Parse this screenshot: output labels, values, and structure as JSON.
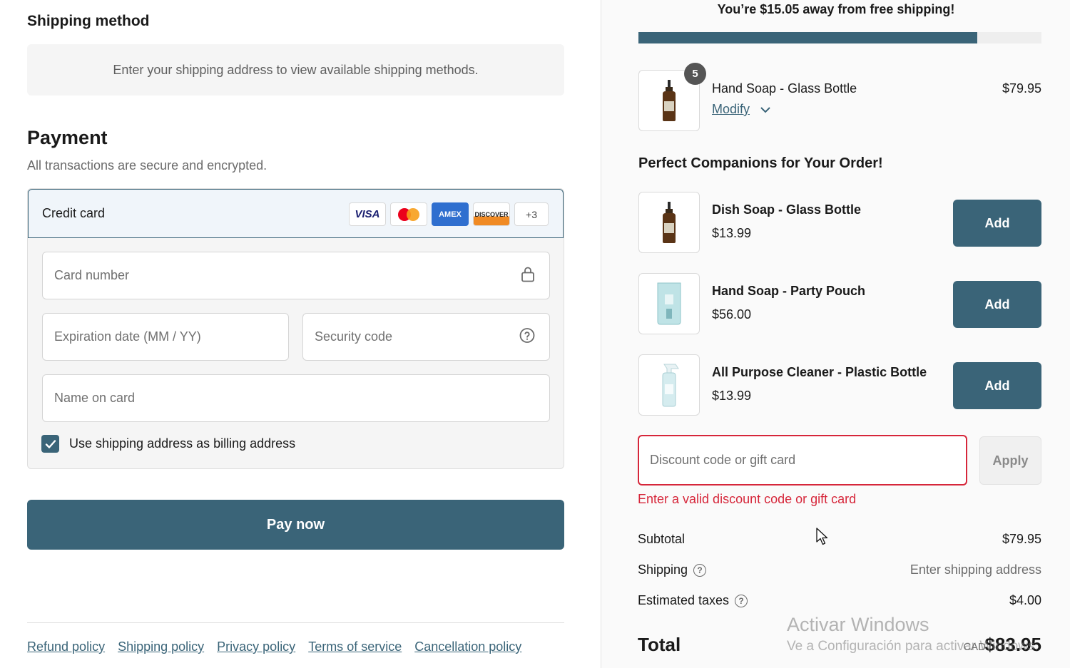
{
  "shipping": {
    "title": "Shipping method",
    "info": "Enter your shipping address to view available shipping methods."
  },
  "payment": {
    "title": "Payment",
    "subtitle": "All transactions are secure and encrypted.",
    "method_label": "Credit card",
    "brands": [
      "VISA",
      "mastercard",
      "AMEX",
      "DISCOVER"
    ],
    "brands_more": "+3",
    "card_number_placeholder": "Card number",
    "expiry_placeholder": "Expiration date (MM / YY)",
    "security_placeholder": "Security code",
    "name_placeholder": "Name on card",
    "billing_checkbox_label": "Use shipping address as billing address",
    "billing_checked": true,
    "pay_button": "Pay now"
  },
  "footer": {
    "links": [
      "Refund policy",
      "Shipping policy",
      "Privacy policy",
      "Terms of service",
      "Cancellation policy"
    ]
  },
  "cart": {
    "free_shipping_message": "You’re $15.05 away from free shipping!",
    "free_shipping_progress": 0.84,
    "item": {
      "quantity": "5",
      "name": "Hand Soap - Glass Bottle",
      "price": "$79.95",
      "modify_label": "Modify"
    },
    "companions_title": "Perfect Companions for Your Order!",
    "companions": [
      {
        "name": "Dish Soap - Glass Bottle",
        "price": "$13.99",
        "button": "Add"
      },
      {
        "name": "Hand Soap - Party Pouch",
        "price": "$56.00",
        "button": "Add"
      },
      {
        "name": "All Purpose Cleaner - Plastic Bottle",
        "price": "$13.99",
        "button": "Add"
      }
    ],
    "discount_placeholder": "Discount code or gift card",
    "apply_button": "Apply",
    "discount_error": "Enter a valid discount code or gift card",
    "subtotal_label": "Subtotal",
    "subtotal_value": "$79.95",
    "shipping_label": "Shipping",
    "shipping_value": "Enter shipping address",
    "taxes_label": "Estimated taxes",
    "taxes_value": "$4.00",
    "total_label": "Total",
    "total_currency": "CAD",
    "total_value": "$83.95"
  },
  "watermark": {
    "title": "Activar Windows",
    "subtitle": "Ve a Configuración para activar Windows."
  },
  "colors": {
    "accent": "#3a6478",
    "error": "#d6263a"
  }
}
